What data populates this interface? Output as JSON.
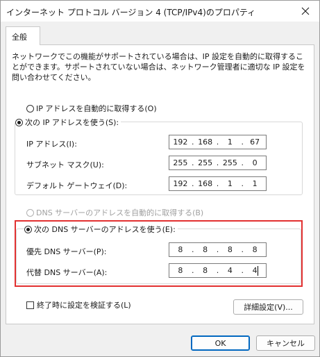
{
  "window": {
    "title": "インターネット プロトコル バージョン 4 (TCP/IPv4)のプロパティ"
  },
  "tabs": [
    {
      "label": "全般"
    }
  ],
  "description": "ネットワークでこの機能がサポートされている場合は、IP 設定を自動的に取得することができます。サポートされていない場合は、ネットワーク管理者に適切な IP 設定を問い合わせてください。",
  "ip_section": {
    "auto_label": "IP アドレスを自動的に取得する(O)",
    "manual_label": "次の IP アドレスを使う(S):",
    "fields": [
      {
        "label": "IP アドレス(I):",
        "octets": [
          "192",
          "168",
          "1",
          "67"
        ]
      },
      {
        "label": "サブネット マスク(U):",
        "octets": [
          "255",
          "255",
          "255",
          "0"
        ]
      },
      {
        "label": "デフォルト ゲートウェイ(D):",
        "octets": [
          "192",
          "168",
          "1",
          "1"
        ]
      }
    ]
  },
  "dns_section": {
    "auto_label": "DNS サーバーのアドレスを自動的に取得する(B)",
    "manual_label": "次の DNS サーバーのアドレスを使う(E):",
    "fields": [
      {
        "label": "優先 DNS サーバー(P):",
        "octets": [
          "8",
          "8",
          "8",
          "8"
        ]
      },
      {
        "label": "代替 DNS サーバー(A):",
        "octets": [
          "8",
          "8",
          "4",
          "4"
        ]
      }
    ]
  },
  "validate_label": "終了時に設定を検証する(L)",
  "advanced_button": "詳細設定(V)...",
  "ok_button": "OK",
  "cancel_button": "キャンセル",
  "colors": {
    "highlight": "#e23030",
    "primary_border": "#0067c0"
  }
}
